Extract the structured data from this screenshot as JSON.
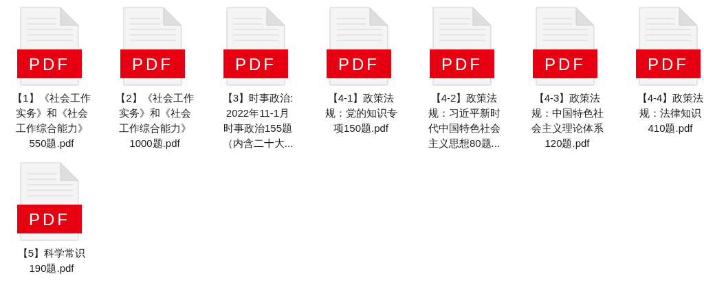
{
  "files": [
    {
      "badge": "PDF",
      "lines": [
        "【1】《社会工作",
        "实务》和《社会",
        "工作综合能力》",
        "550题.pdf"
      ]
    },
    {
      "badge": "PDF",
      "lines": [
        "【2】《社会工作",
        "实务》和《社会",
        "工作综合能力》",
        "1000题.pdf"
      ]
    },
    {
      "badge": "PDF",
      "lines": [
        "【3】时事政治:",
        "2022年11-1月",
        "时事政治155题",
        "（内含二十大..."
      ]
    },
    {
      "badge": "PDF",
      "lines": [
        "【4-1】政策法",
        "规：党的知识专",
        "项150题.pdf"
      ]
    },
    {
      "badge": "PDF",
      "lines": [
        "【4-2】政策法",
        "规：习近平新时",
        "代中国特色社会",
        "主义思想80题..."
      ]
    },
    {
      "badge": "PDF",
      "lines": [
        "【4-3】政策法",
        "规：中国特色社",
        "会主义理论体系",
        "120题.pdf"
      ]
    },
    {
      "badge": "PDF",
      "lines": [
        "【4-4】政策法",
        "规：法律知识",
        "410题.pdf"
      ]
    },
    {
      "badge": "PDF",
      "lines": [
        "【5】科学常识",
        "190题.pdf"
      ]
    }
  ]
}
